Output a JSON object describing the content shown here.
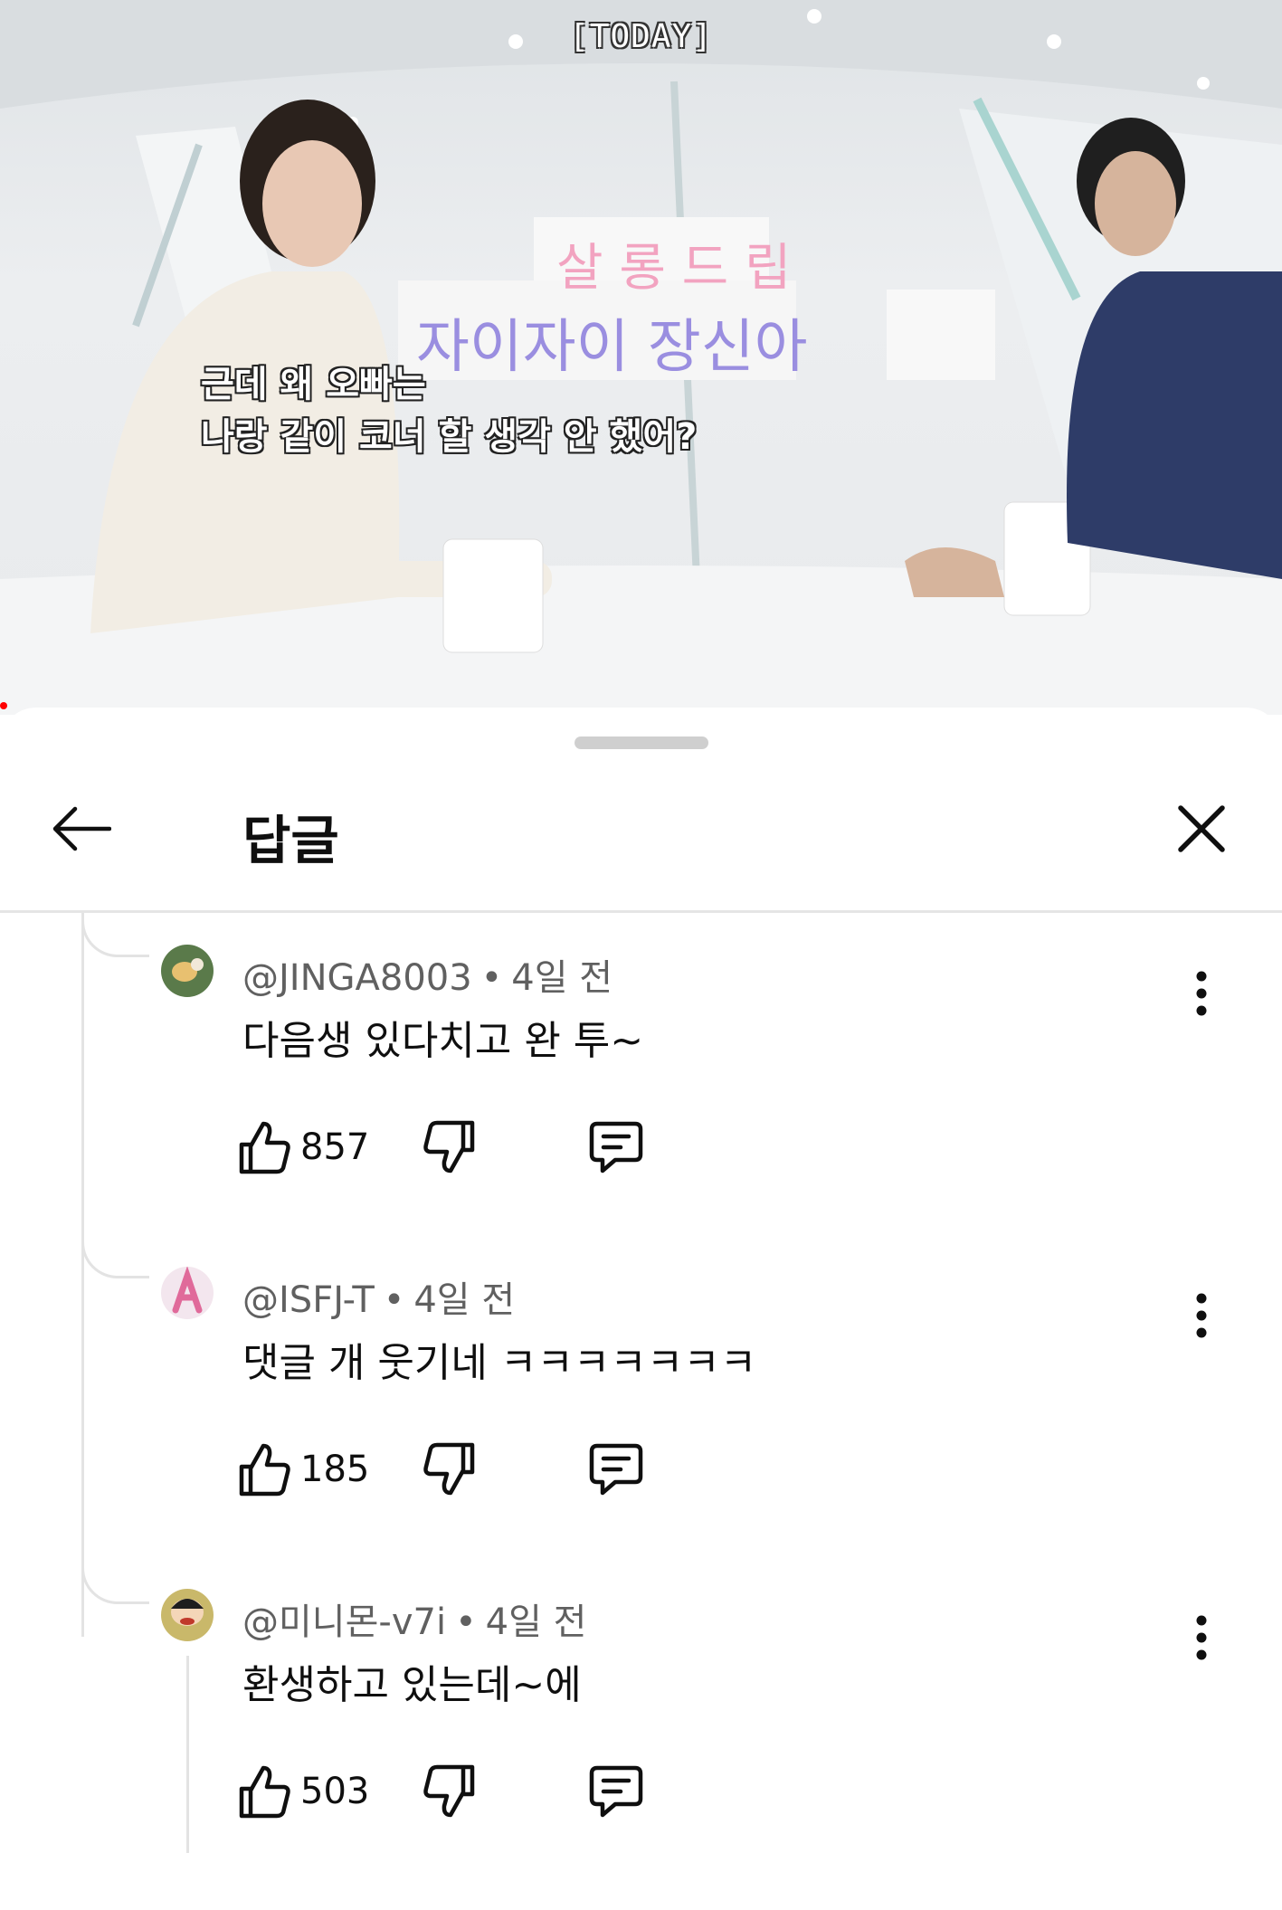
{
  "video": {
    "top_caption": "[TODAY]",
    "subtitle_line1": "근데 왜 오빠는",
    "subtitle_line2": "나랑 같이 코너 할 생각 안 했어?",
    "board_line1": "살롱 드립",
    "board_line2": "자이자이 장신아"
  },
  "header": {
    "back_icon": "arrow-left-icon",
    "title": "답글",
    "close_icon": "close-icon"
  },
  "comments": [
    {
      "author": "@JINGA8003",
      "time": "4일 전",
      "text": "다음생 있다치고 완 투~",
      "likes": "857",
      "avatar_color": "#5a7a4a"
    },
    {
      "author": "@ISFJ-T",
      "time": "4일 전",
      "text": "댓글 개 웃기네 ㅋㅋㅋㅋㅋㅋㅋ",
      "likes": "185",
      "avatar_color": "#f3e6ee"
    },
    {
      "author": "@미니몬-v7i",
      "time": "4일 전",
      "text": "환생하고 있는데~에",
      "likes": "503",
      "avatar_color": "#c9b86a"
    }
  ],
  "icons": {
    "like": "thumbs-up-icon",
    "dislike": "thumbs-down-icon",
    "reply": "comment-icon",
    "more": "more-vertical-icon"
  }
}
